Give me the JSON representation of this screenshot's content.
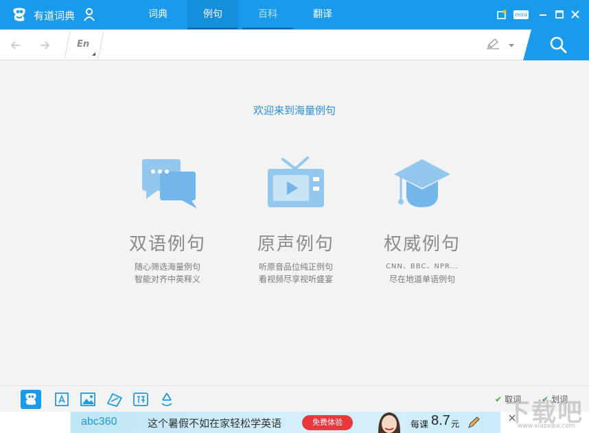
{
  "titlebar": {
    "app_name": "有道词典",
    "tabs": [
      {
        "label": "词典",
        "state": "normal"
      },
      {
        "label": "例句",
        "state": "active"
      },
      {
        "label": "百科",
        "state": "hover"
      },
      {
        "label": "翻译",
        "state": "normal"
      }
    ],
    "mini_label": "mini",
    "colors": {
      "bar": "#1a9aea",
      "active_underline": "#0d6fb8"
    }
  },
  "searchbar": {
    "lang": "En",
    "query": ""
  },
  "main": {
    "welcome": "欢迎来到海量例句",
    "features": [
      {
        "icon": "chat-bubbles-icon",
        "name": "双语例句",
        "desc1": "随心筛选海量例句",
        "desc2": "智能对齐中英释义"
      },
      {
        "icon": "tv-icon",
        "name": "原声例句",
        "desc1": "听原音品位纯正例句",
        "desc2": "看视频尽享视听盛宴"
      },
      {
        "icon": "graduation-cap-icon",
        "name": "权威例句",
        "desc1": "CNN、BBC、NPR...",
        "desc2": "尽在地道单语例句"
      }
    ]
  },
  "bottombar": {
    "tools": [
      "dictionary-icon",
      "word-card-icon",
      "image-translate-icon",
      "wordbook-icon",
      "translate-icon",
      "recycle-icon"
    ],
    "checks": [
      {
        "label": "取词",
        "checked": true
      },
      {
        "label": "划词",
        "checked": true
      }
    ]
  },
  "ad": {
    "brand": "abc360",
    "text": "这个暑假不如在家轻松学英语",
    "button": "免费体验",
    "price_label": "每课",
    "price": "8.7",
    "unit": "元"
  },
  "watermark": {
    "text": "下载吧",
    "url": "www.xiazaiba.com"
  }
}
